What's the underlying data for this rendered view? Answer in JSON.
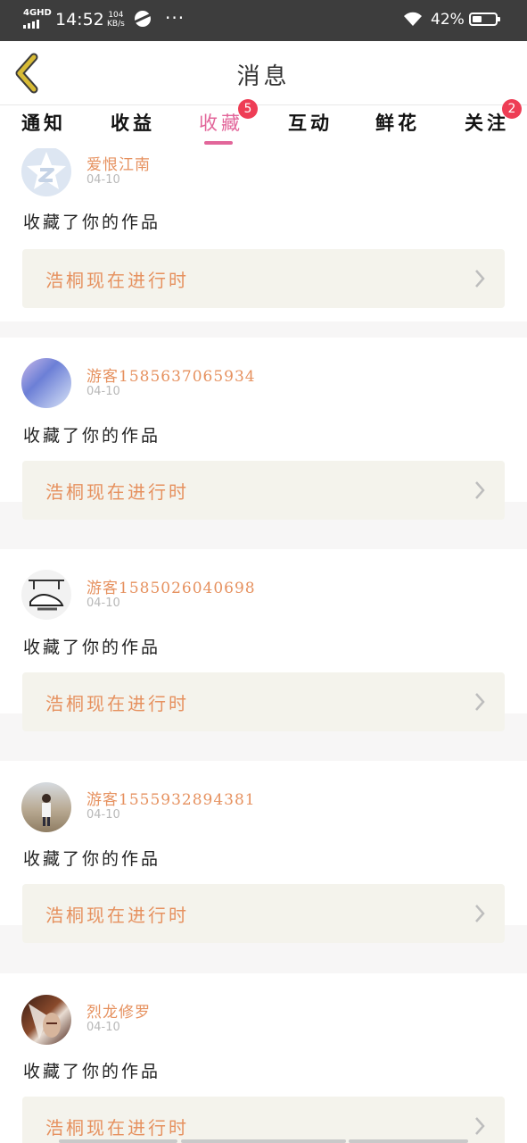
{
  "status_bar": {
    "network": "4GHD",
    "time": "14:52",
    "speed_value": "104",
    "speed_unit": "KB/s",
    "more": "···",
    "battery": "42%",
    "battery_level": 0.42
  },
  "header": {
    "title": "消息"
  },
  "tabs": [
    {
      "label": "通知"
    },
    {
      "label": "收益"
    },
    {
      "label": "收藏",
      "active": true,
      "badge": "5"
    },
    {
      "label": "互动"
    },
    {
      "label": "鲜花"
    },
    {
      "label": "关注",
      "badge": "2"
    }
  ],
  "messages": [
    {
      "user": "爱恨江南",
      "date": "04-10",
      "action": "收藏了你的作品",
      "work": "浩桐现在进行时"
    },
    {
      "user": "游客1585637065934",
      "date": "04-10",
      "action": "收藏了你的作品",
      "work": "浩桐现在进行时"
    },
    {
      "user": "游客1585026040698",
      "date": "04-10",
      "action": "收藏了你的作品",
      "work": "浩桐现在进行时"
    },
    {
      "user": "游客1555932894381",
      "date": "04-10",
      "action": "收藏了你的作品",
      "work": "浩桐现在进行时"
    },
    {
      "user": "烈龙修罗",
      "date": "04-10",
      "action": "收藏了你的作品",
      "work": "浩桐现在进行时"
    }
  ],
  "colors": {
    "accent": "#e2669a",
    "username": "#e6915f",
    "badge": "#ee3d55",
    "work_bg": "#f4f3ec",
    "back_arrow": "#c9a92e"
  },
  "icons": {
    "back": "back-arrow-icon",
    "chevron": "chevron-right-icon"
  }
}
